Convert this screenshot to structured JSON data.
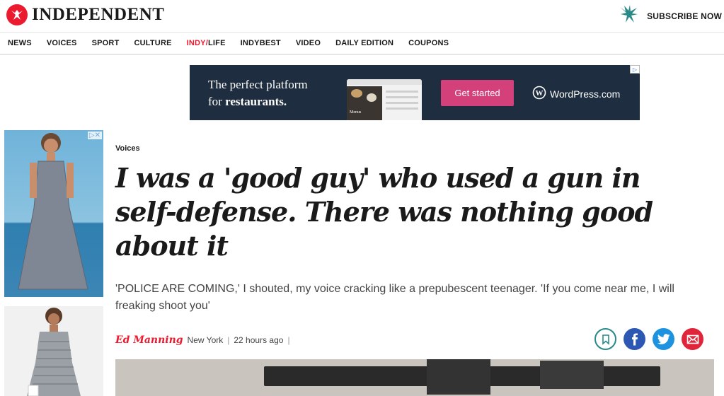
{
  "header": {
    "logo_text": "INDEPENDENT",
    "subscribe_label": "SUBSCRIBE NOW"
  },
  "nav": {
    "items": [
      "NEWS",
      "VOICES",
      "SPORT",
      "CULTURE",
      "INDY/LIFE",
      "INDYBEST",
      "VIDEO",
      "DAILY EDITION",
      "COUPONS"
    ],
    "indy_prefix": "INDY/",
    "indy_suffix": "LIFE"
  },
  "ad": {
    "line1": "The perfect platform",
    "line2_prefix": "for ",
    "line2_bold": "restaurants.",
    "mock_caption": "Menus",
    "cta_label": "Get started",
    "brand": "WordPress.com"
  },
  "article": {
    "section": "Voices",
    "headline": "I was a 'good guy' who used a gun in self-defense. There was nothing good about it",
    "standfirst": "'POLICE ARE COMING,'  I shouted, my voice cracking like a prepubescent teenager. 'If you come near me, I will freaking shoot you'",
    "author": "Ed Manning",
    "location": "New York",
    "time": "22 hours ago"
  },
  "colors": {
    "brand_red": "#ec1a2e",
    "ad_bg": "#1e2d3f",
    "ad_cta": "#d4417a",
    "facebook": "#2c58b3",
    "twitter": "#1d93e0",
    "email": "#e0243a",
    "bookmark": "#2a8a8a"
  },
  "icons": [
    "independent-eagle-logo-icon",
    "eagle-icon",
    "wordpress-icon",
    "bookmark-icon",
    "facebook-icon",
    "twitter-icon",
    "email-icon",
    "ad-choices-icon"
  ]
}
